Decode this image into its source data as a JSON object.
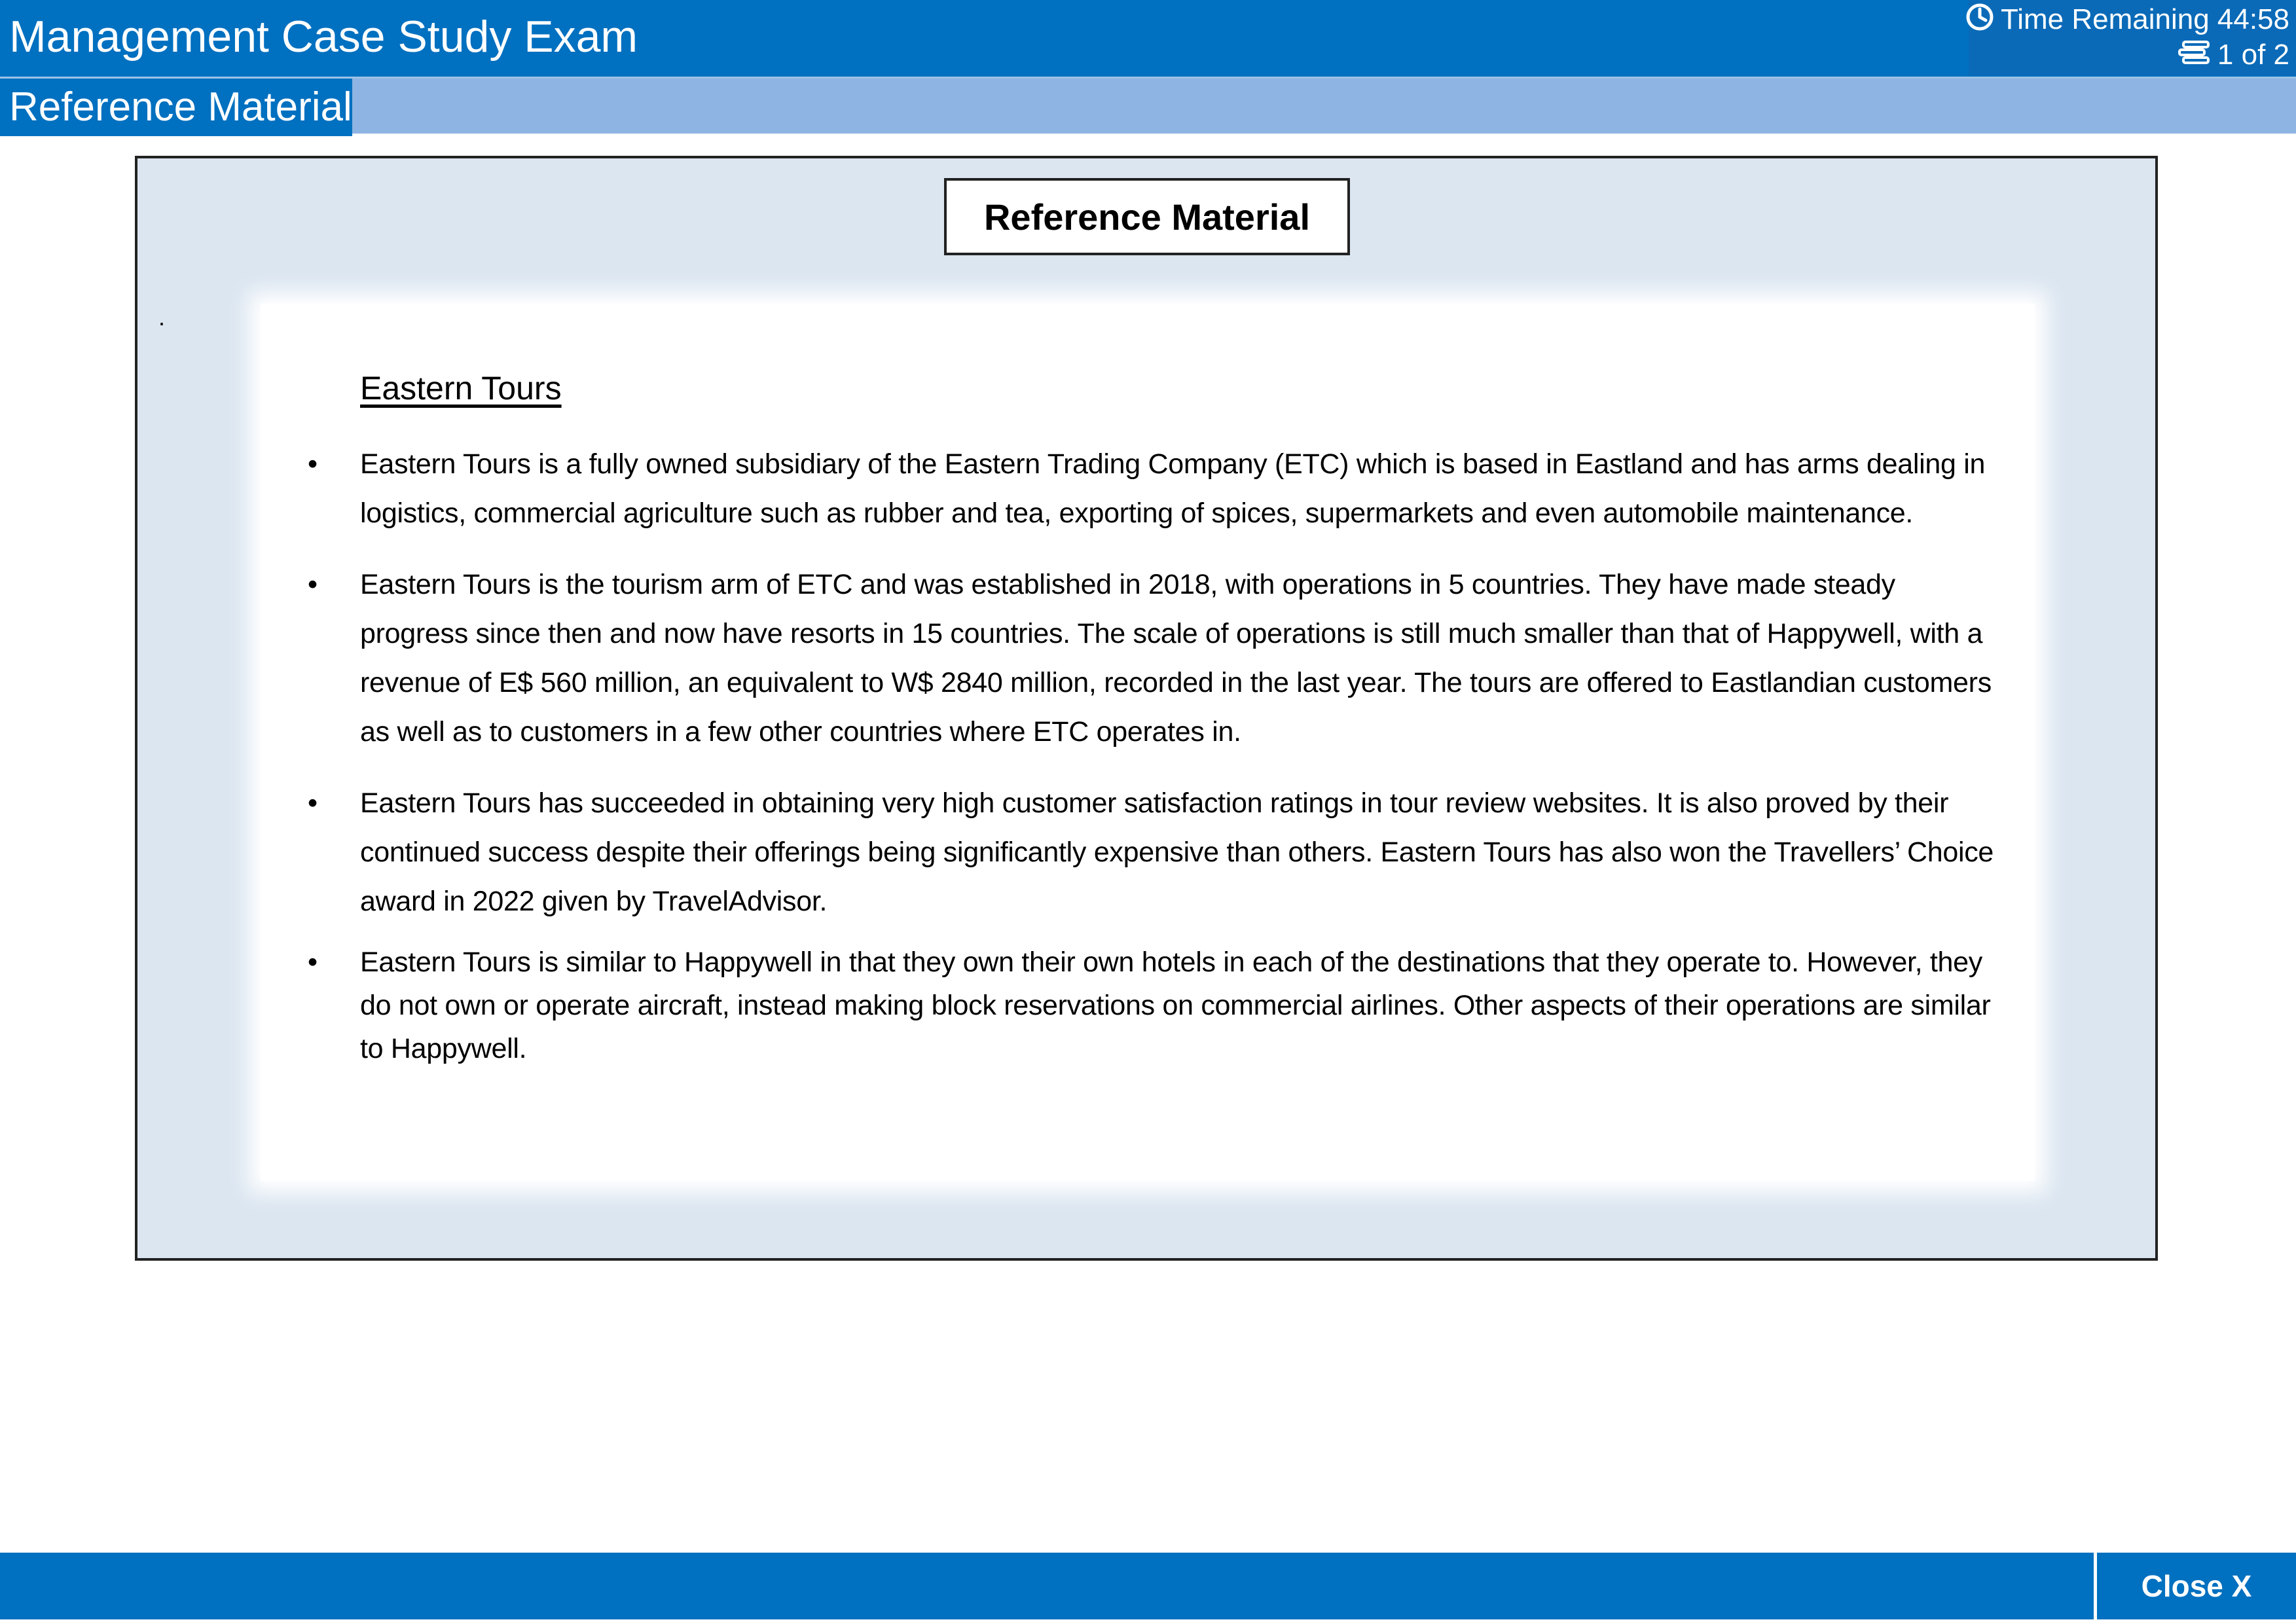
{
  "header": {
    "title": "Management Case Study Exam",
    "timer_label": "Time Remaining 44:58",
    "page_indicator": "1 of 2",
    "timer_icon": "clock-icon",
    "page_icon": "stack-icon"
  },
  "subbar": {
    "tab_label": "Reference Material"
  },
  "panel": {
    "heading": "Reference Material",
    "stray_mark": ".",
    "section_title": "Eastern Tours",
    "bullets": [
      "Eastern Tours is a fully owned subsidiary of the Eastern Trading Company (ETC) which is based in Eastland and has arms dealing in logistics, commercial agriculture such as rubber and tea, exporting of spices, supermarkets and even automobile maintenance.",
      "Eastern Tours is the tourism arm of ETC and was established in 2018, with operations in 5 countries. They have made steady progress since then and now have resorts in 15 countries. The scale of operations is still much smaller than that of Happywell, with a revenue of E$ 560 million, an equivalent to W$ 2840 million, recorded in the last year. The tours are offered to Eastlandian customers as well as to customers in a few other countries where ETC operates in.",
      "Eastern Tours has succeeded in obtaining very high customer satisfaction ratings in tour review websites. It is also proved by their continued success despite their offerings being significantly expensive than others. Eastern Tours has also won the Travellers’ Choice award in 2022 given by TravelAdvisor.",
      "Eastern Tours is similar to Happywell in that they own their own hotels in each of the destinations that they operate to. However, they do not own or operate aircraft, instead making block reservations on commercial airlines. Other aspects of their operations are similar to Happywell."
    ],
    "bullet_marker": "•"
  },
  "footer": {
    "close_label": "Close X"
  },
  "colors": {
    "header_blue": "#0070c0",
    "subbar_blue": "#8db4e2",
    "panel_bg": "#dce6f1"
  }
}
